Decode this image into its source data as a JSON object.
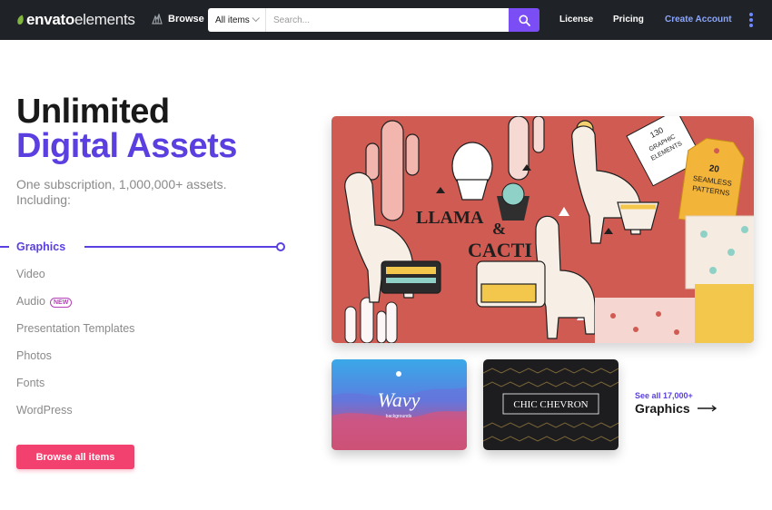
{
  "header": {
    "logo_bold": "envato",
    "logo_light": "elements",
    "browse_label": "Browse",
    "search": {
      "category": "All items",
      "placeholder": "Search..."
    },
    "nav": {
      "license": "License",
      "pricing": "Pricing",
      "create_account": "Create Account"
    }
  },
  "hero": {
    "title_line1": "Unlimited",
    "title_line2": "Digital Assets",
    "subtitle": "One subscription, 1,000,000+ assets. Including:",
    "categories": [
      {
        "label": "Graphics",
        "active": true
      },
      {
        "label": "Video"
      },
      {
        "label": "Audio",
        "badge": "NEW"
      },
      {
        "label": "Presentation Templates"
      },
      {
        "label": "Photos"
      },
      {
        "label": "Fonts"
      },
      {
        "label": "WordPress"
      }
    ],
    "cta_label": "Browse all items"
  },
  "showcase": {
    "main_texts": [
      "LLAMA",
      "&",
      "CACTI",
      "130",
      "GRAPHIC",
      "ELEMENTS",
      "20",
      "SEAMLESS",
      "PATTERNS"
    ],
    "thumb1_text": "Wavy",
    "thumb1_sub": "backgrounds",
    "thumb2_text": "CHIC CHEVRON",
    "see_all_count": "See all 17,000+",
    "see_all_category": "Graphics"
  },
  "colors": {
    "brand_purple": "#5b3fe0",
    "cta_pink": "#f2416e",
    "topbar": "#1f2226",
    "search_button": "#7b4ef5"
  }
}
